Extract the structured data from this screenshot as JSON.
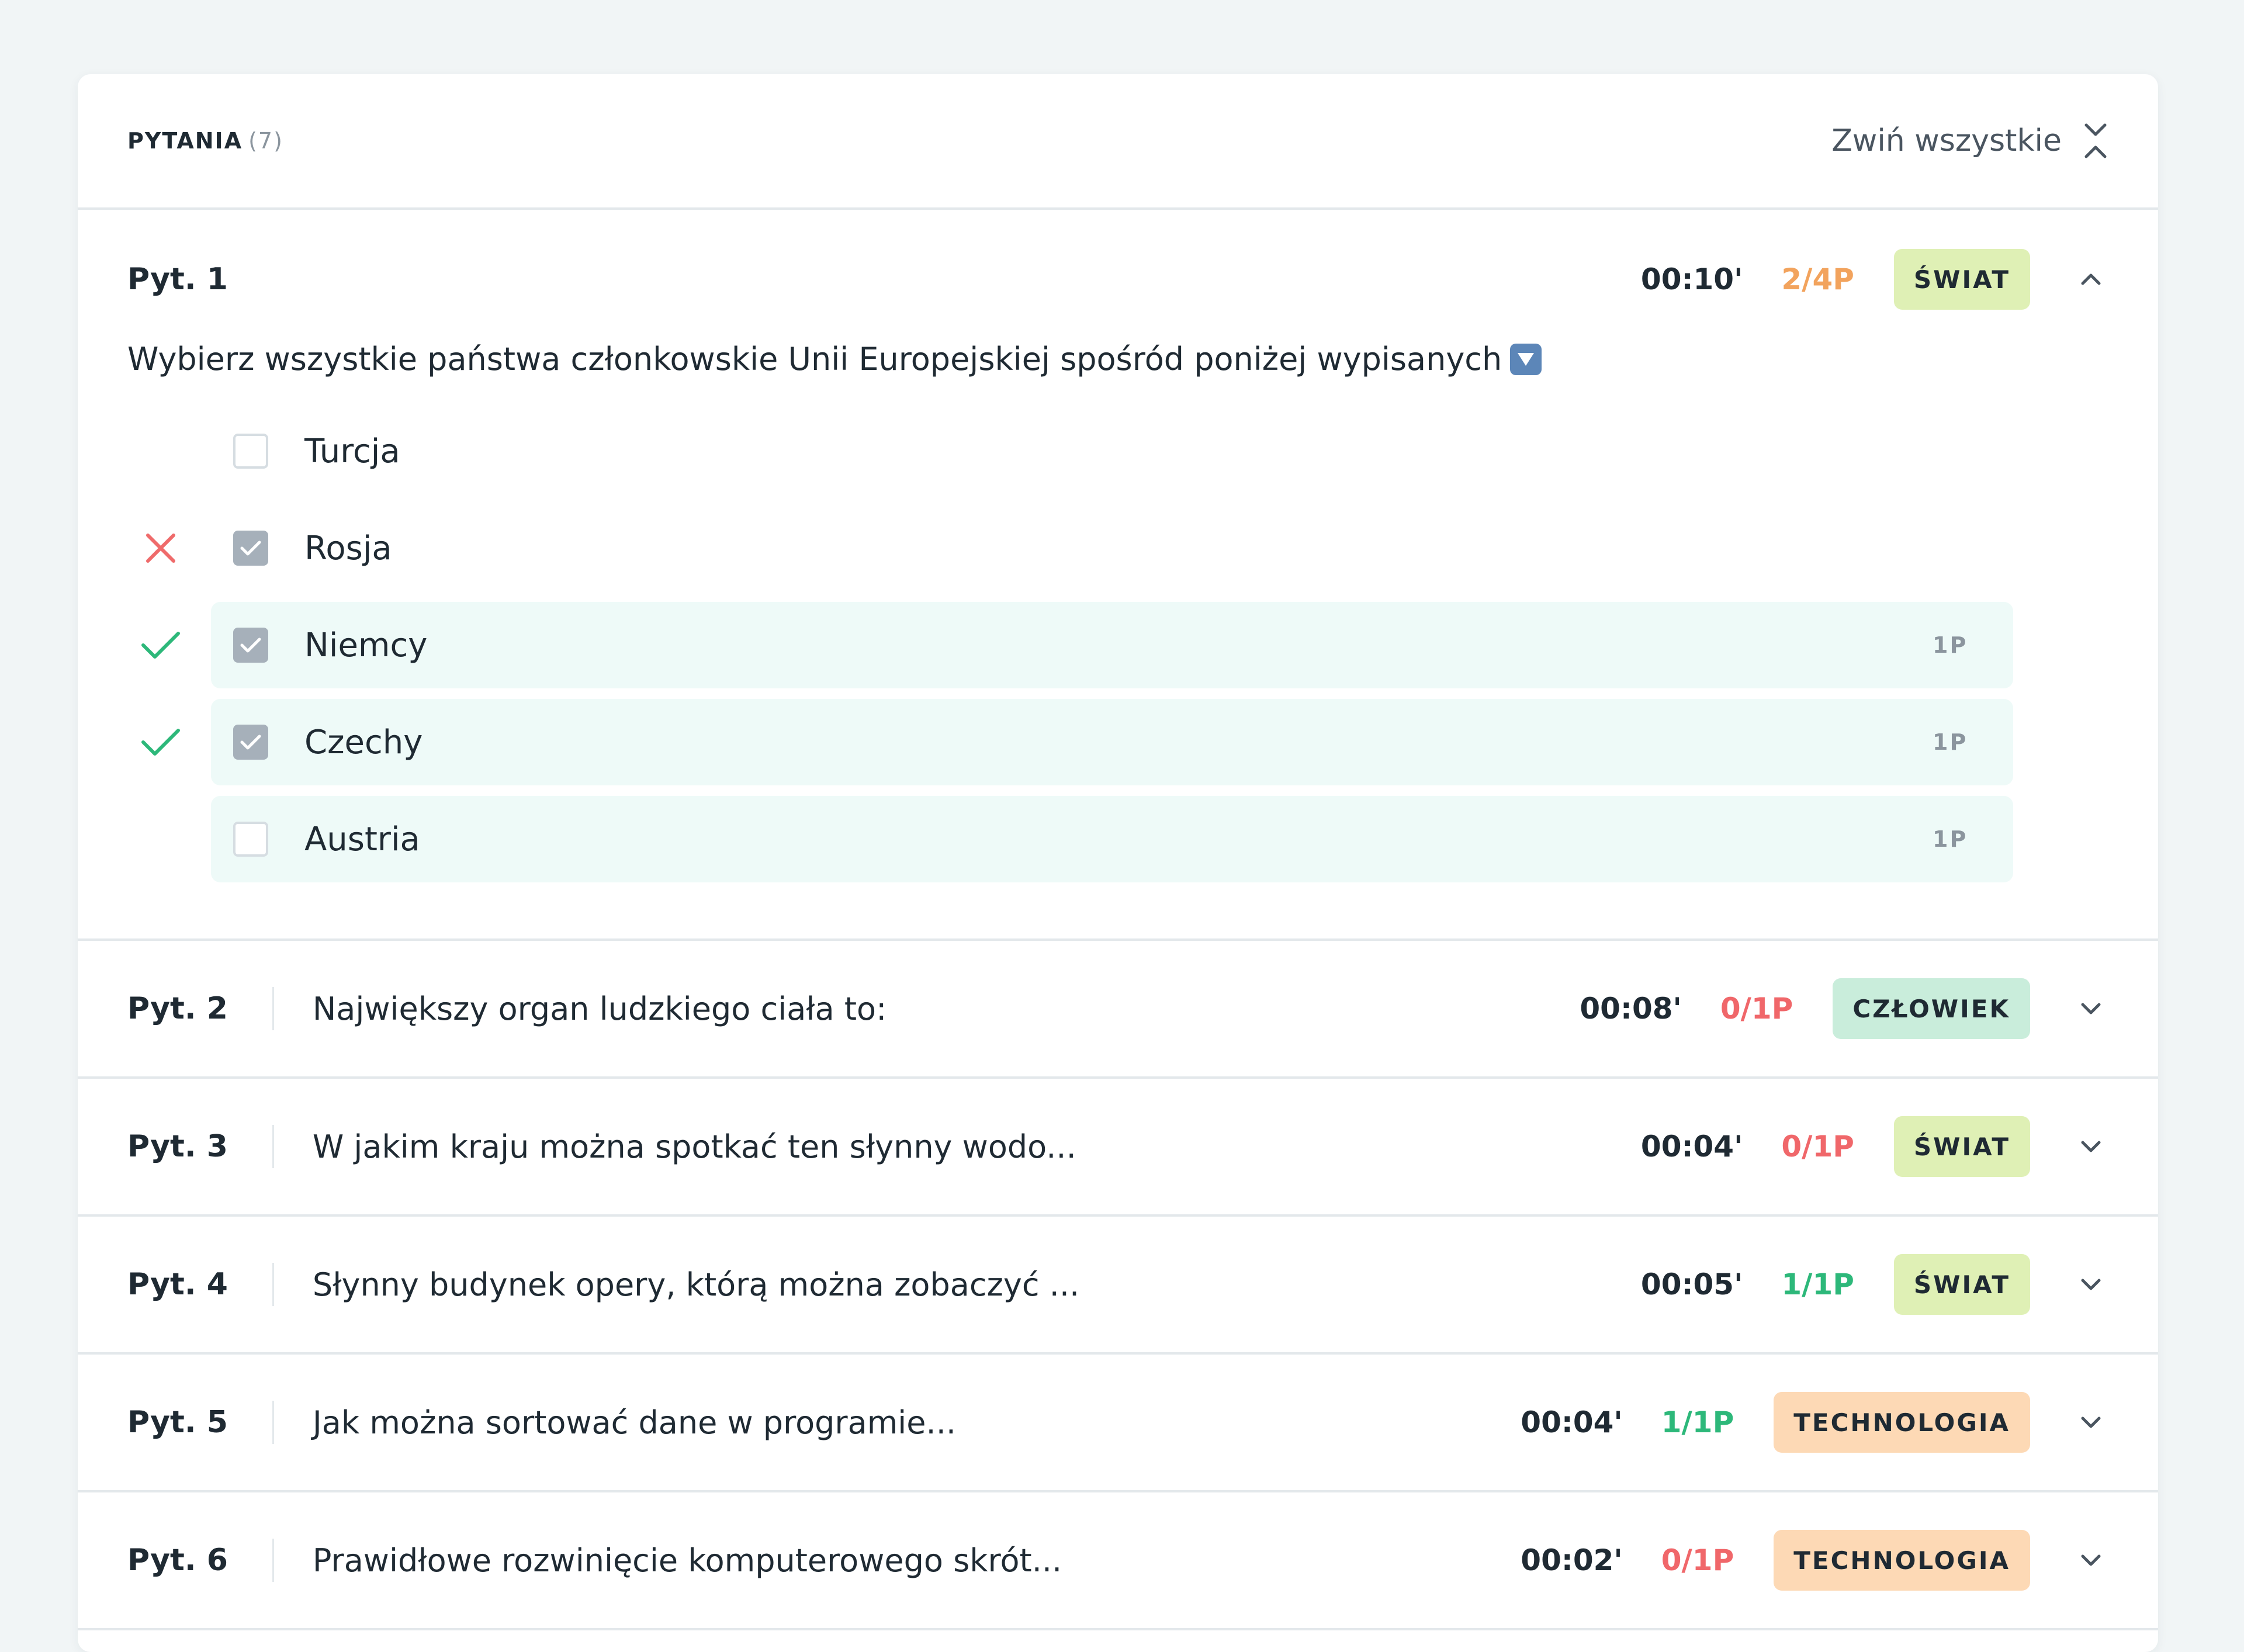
{
  "header": {
    "title": "PYTANIA",
    "count": "(7)",
    "collapse_label": "Zwiń wszystkie"
  },
  "expanded_question": {
    "number": "Pyt. 1",
    "time": "00:10'",
    "score": "2/4P",
    "category": "ŚWIAT",
    "text": "Wybierz wszystkie państwa członkowskie Unii Europejskiej spośród poniżej wypisanych",
    "answers": [
      {
        "label": "Turcja",
        "checked": false,
        "result": "none",
        "points": "",
        "correct": false
      },
      {
        "label": "Rosja",
        "checked": true,
        "result": "wrong",
        "points": "",
        "correct": false
      },
      {
        "label": "Niemcy",
        "checked": true,
        "result": "right",
        "points": "1P",
        "correct": true
      },
      {
        "label": "Czechy",
        "checked": true,
        "result": "right",
        "points": "1P",
        "correct": true
      },
      {
        "label": "Austria",
        "checked": false,
        "result": "none",
        "points": "1P",
        "correct": true
      }
    ]
  },
  "questions": [
    {
      "number": "Pyt. 2",
      "text": "Największy organ ludzkiego ciała to:",
      "time": "00:08'",
      "score": "0/1P",
      "score_state": "red",
      "category": "CZŁOWIEK",
      "category_key": "czlowiek"
    },
    {
      "number": "Pyt. 3",
      "text": "W jakim kraju można spotkać ten słynny wodo...",
      "time": "00:04'",
      "score": "0/1P",
      "score_state": "red",
      "category": "ŚWIAT",
      "category_key": "swiat"
    },
    {
      "number": "Pyt. 4",
      "text": "Słynny budynek opery, którą można zobaczyć ...",
      "time": "00:05'",
      "score": "1/1P",
      "score_state": "green",
      "category": "ŚWIAT",
      "category_key": "swiat"
    },
    {
      "number": "Pyt. 5",
      "text": "Jak można sortować dane w programie...",
      "time": "00:04'",
      "score": "1/1P",
      "score_state": "green",
      "category": "TECHNOLOGIA",
      "category_key": "technologia"
    },
    {
      "number": "Pyt. 6",
      "text": "Prawidłowe rozwinięcie komputerowego skrót...",
      "time": "00:02'",
      "score": "0/1P",
      "score_state": "red",
      "category": "TECHNOLOGIA",
      "category_key": "technologia"
    }
  ],
  "colors": {
    "score_orange": "#f2a35d",
    "score_red": "#f0676a",
    "score_green": "#2db87a",
    "tag_swiat": "#dff0b5",
    "tag_czlowiek": "#c9eddb",
    "tag_technologia": "#fdd9b5",
    "correct_answer_bg": "#eefaf8"
  }
}
